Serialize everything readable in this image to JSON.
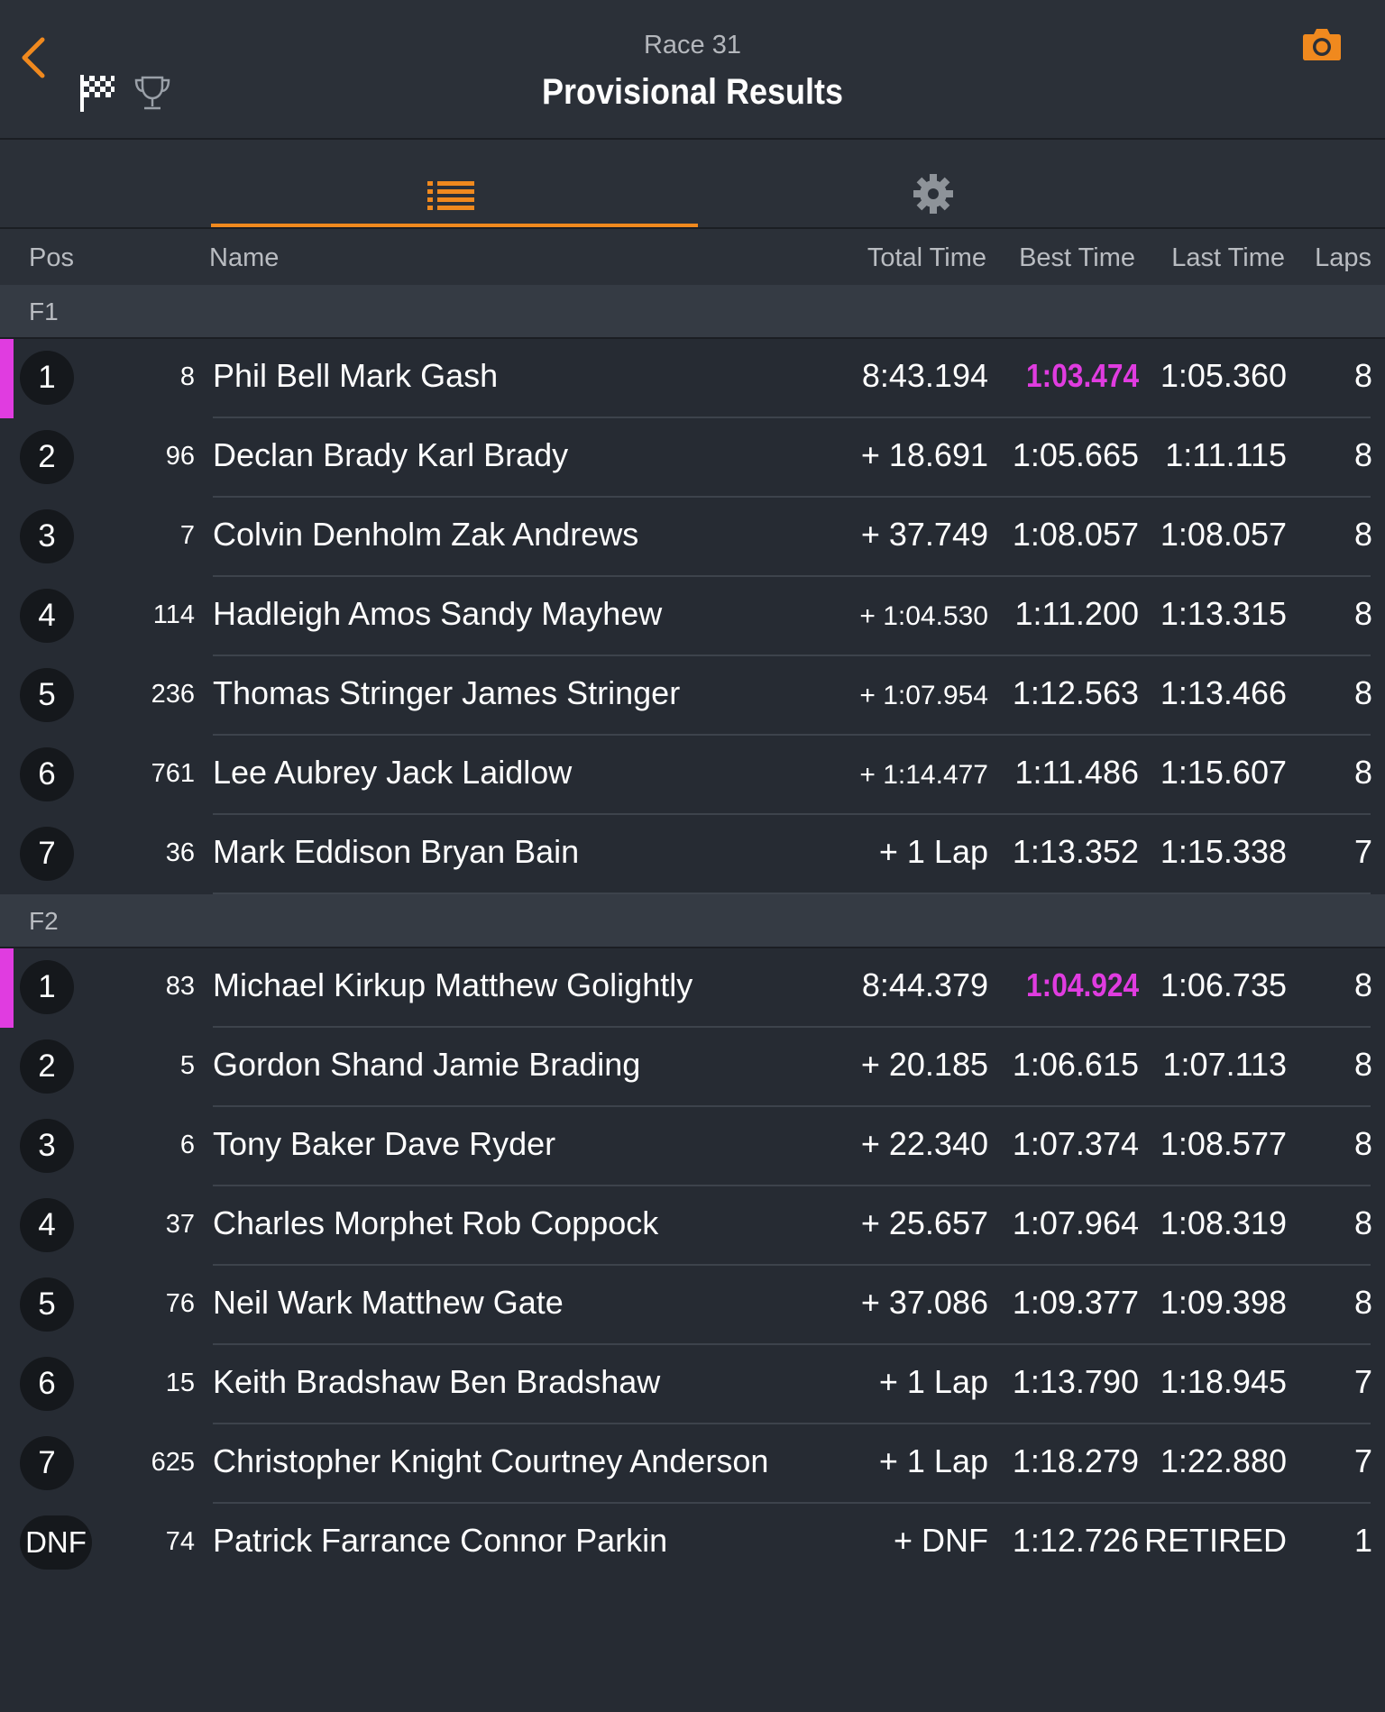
{
  "header": {
    "race": "Race 31",
    "title": "Provisional Results"
  },
  "columns": {
    "pos": "Pos",
    "name": "Name",
    "total": "Total Time",
    "best": "Best Time",
    "last": "Last Time",
    "laps": "Laps"
  },
  "colors": {
    "accent": "#f0891e",
    "fastest": "#e03ce0",
    "background": "#262b33"
  },
  "groups": [
    {
      "label": "F1",
      "rows": [
        {
          "pos": "1",
          "num": "8",
          "name": "Phil Bell Mark Gash",
          "total": "8:43.194",
          "best": "1:03.474",
          "last": "1:05.360",
          "laps": "8",
          "leader": true,
          "fastest": true
        },
        {
          "pos": "2",
          "num": "96",
          "name": "Declan Brady Karl Brady",
          "total": "+ 18.691",
          "best": "1:05.665",
          "last": "1:11.115",
          "laps": "8"
        },
        {
          "pos": "3",
          "num": "7",
          "name": "Colvin Denholm Zak Andrews",
          "total": "+ 37.749",
          "best": "1:08.057",
          "last": "1:08.057",
          "laps": "8"
        },
        {
          "pos": "4",
          "num": "114",
          "name": "Hadleigh Amos Sandy Mayhew",
          "total": "+ 1:04.530",
          "best": "1:11.200",
          "last": "1:13.315",
          "laps": "8",
          "small": true
        },
        {
          "pos": "5",
          "num": "236",
          "name": "Thomas Stringer James Stringer",
          "total": "+ 1:07.954",
          "best": "1:12.563",
          "last": "1:13.466",
          "laps": "8",
          "small": true
        },
        {
          "pos": "6",
          "num": "761",
          "name": "Lee Aubrey Jack Laidlow",
          "total": "+ 1:14.477",
          "best": "1:11.486",
          "last": "1:15.607",
          "laps": "8",
          "small": true
        },
        {
          "pos": "7",
          "num": "36",
          "name": "Mark Eddison Bryan Bain",
          "total": "+ 1 Lap",
          "best": "1:13.352",
          "last": "1:15.338",
          "laps": "7"
        }
      ]
    },
    {
      "label": "F2",
      "rows": [
        {
          "pos": "1",
          "num": "83",
          "name": "Michael Kirkup Matthew Golightly",
          "total": "8:44.379",
          "best": "1:04.924",
          "last": "1:06.735",
          "laps": "8",
          "leader": true,
          "fastest": true
        },
        {
          "pos": "2",
          "num": "5",
          "name": "Gordon Shand Jamie Brading",
          "total": "+ 20.185",
          "best": "1:06.615",
          "last": "1:07.113",
          "laps": "8"
        },
        {
          "pos": "3",
          "num": "6",
          "name": "Tony Baker Dave Ryder",
          "total": "+ 22.340",
          "best": "1:07.374",
          "last": "1:08.577",
          "laps": "8"
        },
        {
          "pos": "4",
          "num": "37",
          "name": "Charles Morphet Rob Coppock",
          "total": "+ 25.657",
          "best": "1:07.964",
          "last": "1:08.319",
          "laps": "8"
        },
        {
          "pos": "5",
          "num": "76",
          "name": "Neil Wark Matthew Gate",
          "total": "+ 37.086",
          "best": "1:09.377",
          "last": "1:09.398",
          "laps": "8"
        },
        {
          "pos": "6",
          "num": "15",
          "name": "Keith Bradshaw Ben Bradshaw",
          "total": "+ 1 Lap",
          "best": "1:13.790",
          "last": "1:18.945",
          "laps": "7"
        },
        {
          "pos": "7",
          "num": "625",
          "name": "Christopher Knight Courtney Anderson",
          "total": "+ 1 Lap",
          "best": "1:18.279",
          "last": "1:22.880",
          "laps": "7"
        },
        {
          "pos": "DNF",
          "num": "74",
          "name": "Patrick Farrance Connor Parkin",
          "total": "+ DNF",
          "best": "1:12.726",
          "last": "RETIRED",
          "laps": "1",
          "wide": true
        }
      ]
    }
  ]
}
